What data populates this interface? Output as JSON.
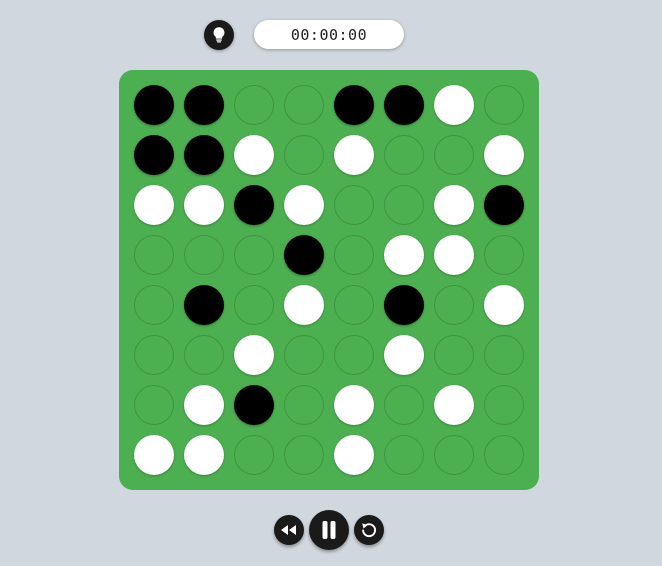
{
  "header": {
    "hint_icon": "lightbulb-icon",
    "timer_text": "00:00:00"
  },
  "board": {
    "rows": 8,
    "cols": 8,
    "colors": {
      "board": "#4caf50",
      "black": "#000000",
      "white": "#ffffff",
      "empty_outline": "#3f9542"
    },
    "cells": [
      [
        "black",
        "black",
        "empty",
        "empty",
        "black",
        "black",
        "white",
        "empty"
      ],
      [
        "black",
        "black",
        "white",
        "empty",
        "white",
        "empty",
        "empty",
        "white"
      ],
      [
        "white",
        "white",
        "black",
        "white",
        "empty",
        "empty",
        "white",
        "black"
      ],
      [
        "empty",
        "empty",
        "empty",
        "black",
        "empty",
        "white",
        "white",
        "empty"
      ],
      [
        "empty",
        "black",
        "empty",
        "white",
        "empty",
        "black",
        "empty",
        "white"
      ],
      [
        "empty",
        "empty",
        "white",
        "empty",
        "empty",
        "white",
        "empty",
        "empty"
      ],
      [
        "empty",
        "white",
        "black",
        "empty",
        "white",
        "empty",
        "white",
        "empty"
      ],
      [
        "white",
        "white",
        "empty",
        "empty",
        "white",
        "empty",
        "empty",
        "empty"
      ]
    ]
  },
  "controls": {
    "rewind_icon": "rewind-icon",
    "pause_icon": "pause-icon",
    "restart_icon": "restart-icon"
  }
}
